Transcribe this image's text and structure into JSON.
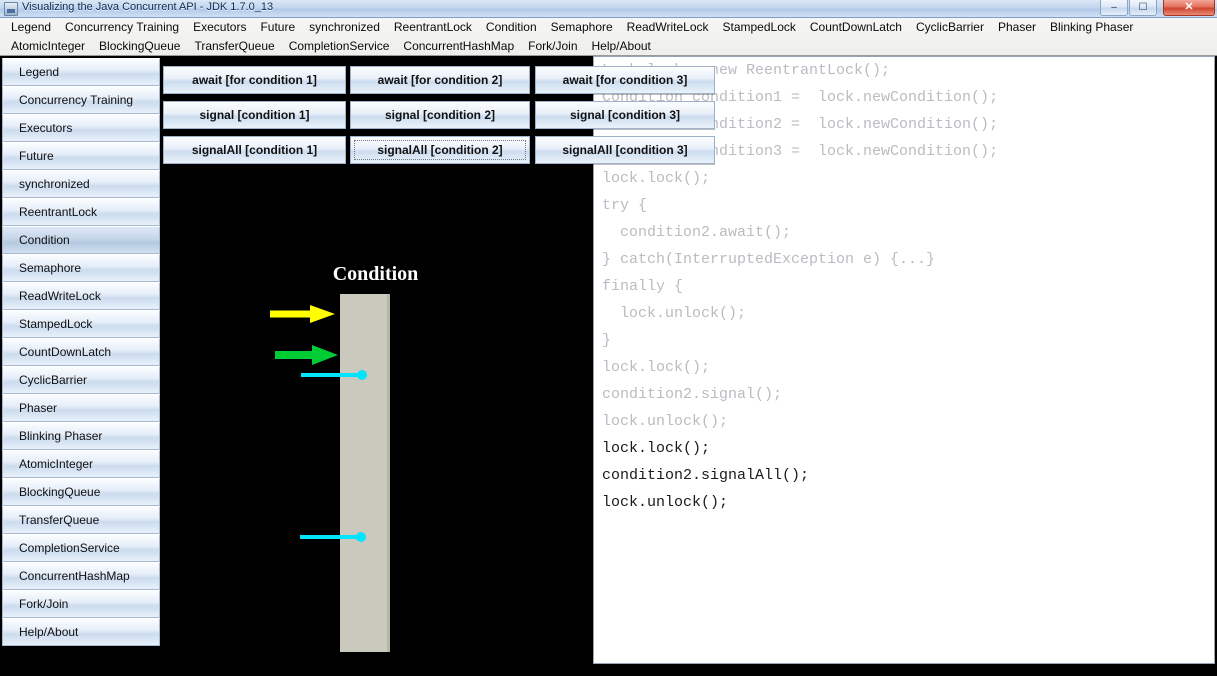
{
  "window": {
    "title": "Visualizing the Java Concurrent API - JDK 1.7.0_13",
    "icon": "app-icon",
    "controls": {
      "minimize": "–",
      "maximize": "☐",
      "close": "✕"
    }
  },
  "menubar": {
    "row1": [
      "Legend",
      "Concurrency Training",
      "Executors",
      "Future",
      "synchronized",
      "ReentrantLock",
      "Condition",
      "Semaphore",
      "ReadWriteLock",
      "StampedLock",
      "CountDownLatch",
      "CyclicBarrier",
      "Phaser",
      "Blinking Phaser"
    ],
    "row2": [
      "AtomicInteger",
      "BlockingQueue",
      "TransferQueue",
      "CompletionService",
      "ConcurrentHashMap",
      "Fork/Join",
      "Help/About"
    ]
  },
  "sidebar": {
    "selected": "Condition",
    "items": [
      "Legend",
      "Concurrency Training",
      "Executors",
      "Future",
      "synchronized",
      "ReentrantLock",
      "Condition",
      "Semaphore",
      "ReadWriteLock",
      "StampedLock",
      "CountDownLatch",
      "CyclicBarrier",
      "Phaser",
      "Blinking Phaser",
      "AtomicInteger",
      "BlockingQueue",
      "TransferQueue",
      "CompletionService",
      "ConcurrentHashMap",
      "Fork/Join",
      "Help/About"
    ]
  },
  "action_buttons": [
    {
      "label": "await [for condition 1]",
      "focused": false
    },
    {
      "label": "await [for condition 2]",
      "focused": false
    },
    {
      "label": "await [for condition 3]",
      "focused": false
    },
    {
      "label": "signal [condition 1]",
      "focused": false
    },
    {
      "label": "signal [condition 2]",
      "focused": false
    },
    {
      "label": "signal [condition 3]",
      "focused": false
    },
    {
      "label": "signalAll [condition 1]",
      "focused": false
    },
    {
      "label": "signalAll [condition 2]",
      "focused": true
    },
    {
      "label": "signalAll [condition 3]",
      "focused": false
    }
  ],
  "visualization": {
    "title": "Condition",
    "bar_color": "#c9c9bd",
    "background_color": "#000000",
    "threads": [
      {
        "id": "thread-yellow",
        "color": "#ffff00",
        "shape": "arrow",
        "label": ""
      },
      {
        "id": "thread-green",
        "color": "#00cc33",
        "shape": "arrow",
        "label": ""
      },
      {
        "id": "thread-cyan-1",
        "color": "#00e5ff",
        "shape": "line-dot",
        "label": ""
      },
      {
        "id": "thread-cyan-2",
        "color": "#00e5ff",
        "shape": "line-dot",
        "label": ""
      }
    ]
  },
  "code": {
    "lines": [
      {
        "text": "Lock lock = new ReentrantLock();",
        "highlight": false
      },
      {
        "text": "Condition condition1 =  lock.newCondition();",
        "highlight": false
      },
      {
        "text": "Condition condition2 =  lock.newCondition();",
        "highlight": false
      },
      {
        "text": "Condition condition3 =  lock.newCondition();",
        "highlight": false
      },
      {
        "text": "",
        "highlight": false
      },
      {
        "text": "",
        "highlight": false
      },
      {
        "text": "lock.lock();",
        "highlight": false
      },
      {
        "text": "try {",
        "highlight": false
      },
      {
        "text": "  condition2.await();",
        "highlight": false
      },
      {
        "text": "} catch(InterruptedException e) {...}",
        "highlight": false
      },
      {
        "text": "finally {",
        "highlight": false
      },
      {
        "text": "  lock.unlock();",
        "highlight": false
      },
      {
        "text": "}",
        "highlight": false
      },
      {
        "text": "",
        "highlight": false
      },
      {
        "text": "lock.lock();",
        "highlight": false
      },
      {
        "text": "condition2.signal();",
        "highlight": false
      },
      {
        "text": "lock.unlock();",
        "highlight": false
      },
      {
        "text": "",
        "highlight": false
      },
      {
        "text": "lock.lock();",
        "highlight": true
      },
      {
        "text": "condition2.signalAll();",
        "highlight": true
      },
      {
        "text": "lock.unlock();",
        "highlight": true
      }
    ]
  }
}
